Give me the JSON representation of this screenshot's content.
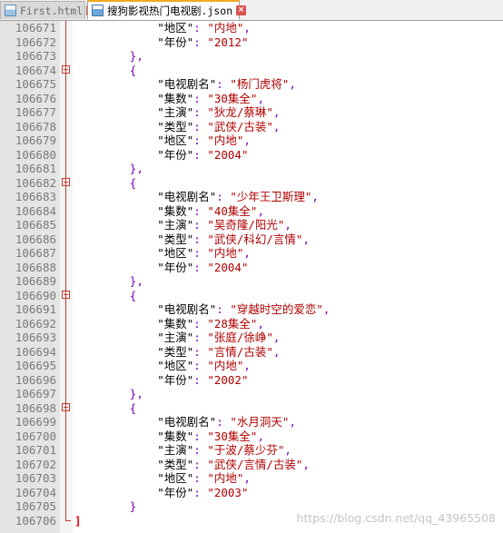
{
  "tabs": [
    {
      "label": "First.html",
      "active": false,
      "icon": "file-icon",
      "close_label": "×"
    },
    {
      "label": "搜狗影视热门电视剧.json",
      "active": true,
      "icon": "file-icon",
      "close_label": "×"
    }
  ],
  "watermark": "https://blog.csdn.net/qq_43965508",
  "lines": [
    {
      "number": "106671",
      "indent": 3,
      "key": "地区",
      "value": "内地",
      "trail": ","
    },
    {
      "number": "106672",
      "indent": 3,
      "key": "年份",
      "value": "2012",
      "trail": ""
    },
    {
      "number": "106673",
      "indent": 2,
      "text": "},",
      "kind": "punct"
    },
    {
      "number": "106674",
      "indent": 2,
      "text": "{",
      "kind": "punct",
      "fold": true
    },
    {
      "number": "106675",
      "indent": 3,
      "key": "电视剧名",
      "value": "杨门虎将",
      "trail": ","
    },
    {
      "number": "106676",
      "indent": 3,
      "key": "集数",
      "value": "30集全",
      "trail": ","
    },
    {
      "number": "106677",
      "indent": 3,
      "key": "主演",
      "value": "狄龙/蔡琳",
      "trail": ","
    },
    {
      "number": "106678",
      "indent": 3,
      "key": "类型",
      "value": "武侠/古装",
      "trail": ","
    },
    {
      "number": "106679",
      "indent": 3,
      "key": "地区",
      "value": "内地",
      "trail": ","
    },
    {
      "number": "106680",
      "indent": 3,
      "key": "年份",
      "value": "2004",
      "trail": ""
    },
    {
      "number": "106681",
      "indent": 2,
      "text": "},",
      "kind": "punct"
    },
    {
      "number": "106682",
      "indent": 2,
      "text": "{",
      "kind": "punct",
      "fold": true
    },
    {
      "number": "106683",
      "indent": 3,
      "key": "电视剧名",
      "value": "少年王卫斯理",
      "trail": ","
    },
    {
      "number": "106684",
      "indent": 3,
      "key": "集数",
      "value": "40集全",
      "trail": ","
    },
    {
      "number": "106685",
      "indent": 3,
      "key": "主演",
      "value": "吴奇隆/阳光",
      "trail": ","
    },
    {
      "number": "106686",
      "indent": 3,
      "key": "类型",
      "value": "武侠/科幻/言情",
      "trail": ","
    },
    {
      "number": "106687",
      "indent": 3,
      "key": "地区",
      "value": "内地",
      "trail": ","
    },
    {
      "number": "106688",
      "indent": 3,
      "key": "年份",
      "value": "2004",
      "trail": ""
    },
    {
      "number": "106689",
      "indent": 2,
      "text": "},",
      "kind": "punct"
    },
    {
      "number": "106690",
      "indent": 2,
      "text": "{",
      "kind": "punct",
      "fold": true
    },
    {
      "number": "106691",
      "indent": 3,
      "key": "电视剧名",
      "value": "穿越时空的爱恋",
      "trail": ","
    },
    {
      "number": "106692",
      "indent": 3,
      "key": "集数",
      "value": "28集全",
      "trail": ","
    },
    {
      "number": "106693",
      "indent": 3,
      "key": "主演",
      "value": "张庭/徐峥",
      "trail": ","
    },
    {
      "number": "106694",
      "indent": 3,
      "key": "类型",
      "value": "言情/古装",
      "trail": ","
    },
    {
      "number": "106695",
      "indent": 3,
      "key": "地区",
      "value": "内地",
      "trail": ","
    },
    {
      "number": "106696",
      "indent": 3,
      "key": "年份",
      "value": "2002",
      "trail": ""
    },
    {
      "number": "106697",
      "indent": 2,
      "text": "},",
      "kind": "punct"
    },
    {
      "number": "106698",
      "indent": 2,
      "text": "{",
      "kind": "punct",
      "fold": true
    },
    {
      "number": "106699",
      "indent": 3,
      "key": "电视剧名",
      "value": "水月洞天",
      "trail": ","
    },
    {
      "number": "106700",
      "indent": 3,
      "key": "集数",
      "value": "30集全",
      "trail": ","
    },
    {
      "number": "106701",
      "indent": 3,
      "key": "主演",
      "value": "于波/蔡少芬",
      "trail": ","
    },
    {
      "number": "106702",
      "indent": 3,
      "key": "类型",
      "value": "武侠/言情/古装",
      "trail": ","
    },
    {
      "number": "106703",
      "indent": 3,
      "key": "地区",
      "value": "内地",
      "trail": ","
    },
    {
      "number": "106704",
      "indent": 3,
      "key": "年份",
      "value": "2003",
      "trail": ""
    },
    {
      "number": "106705",
      "indent": 2,
      "text": "}",
      "kind": "punct"
    },
    {
      "number": "106706",
      "indent": 0,
      "text": "]",
      "kind": "bracket"
    }
  ],
  "colors": {
    "string": "#b00000",
    "punct": "#8000c0",
    "bracket": "#ff0000",
    "fold_marker": "#c0392b",
    "active_tab_accent": "#f2a91f",
    "close_button": "#d9534f"
  }
}
